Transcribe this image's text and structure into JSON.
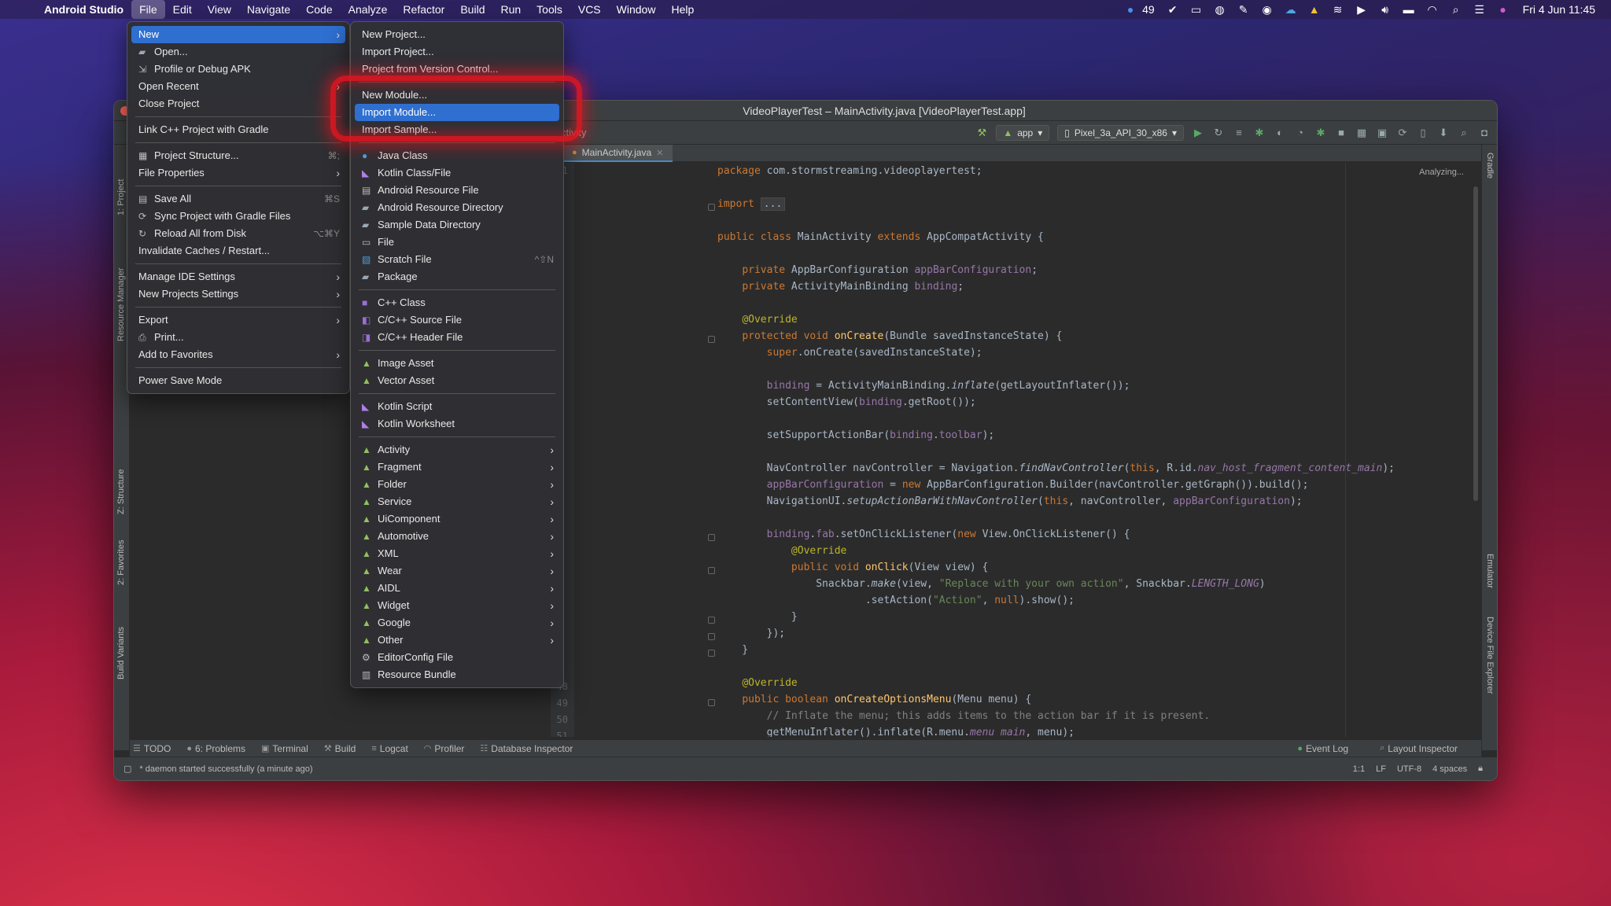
{
  "menubar": {
    "app": "Android Studio",
    "items": [
      "File",
      "Edit",
      "View",
      "Navigate",
      "Code",
      "Analyze",
      "Refactor",
      "Build",
      "Run",
      "Tools",
      "VCS",
      "Window",
      "Help"
    ],
    "badge_count": "49",
    "clock": "Fri 4 Jun  11:45"
  },
  "window": {
    "title": "VideoPlayerTest – MainActivity.java [VideoPlayerTest.app]",
    "breadcrumb": "ctivity",
    "run_config": "app",
    "device": "Pixel_3a_API_30_x86",
    "tab": "MainActivity.java",
    "analyzing": "Analyzing..."
  },
  "side_tabs": {
    "left": [
      "1: Project",
      "Resource Manager",
      "Z: Structure",
      "2: Favorites",
      "Build Variants"
    ],
    "right": [
      "Gradle",
      "Emulator",
      "Device File Explorer"
    ]
  },
  "code": {
    "line_numbers": [
      "1",
      "",
      "",
      "",
      "",
      "",
      "",
      "",
      "",
      "",
      "",
      "",
      "",
      "",
      "",
      "",
      "",
      "",
      "",
      "",
      "",
      "",
      "",
      "",
      "",
      "",
      "",
      "",
      "",
      "",
      "",
      "",
      "48",
      "49",
      "50",
      "51"
    ]
  },
  "bottom_tools": {
    "left": [
      "TODO",
      "6: Problems",
      "Terminal",
      "Build",
      "Logcat",
      "Profiler",
      "Database Inspector"
    ],
    "right": [
      "Event Log",
      "Layout Inspector"
    ]
  },
  "status": {
    "message": "* daemon started successfully (a minute ago)",
    "position": "1:1",
    "line_sep": "LF",
    "encoding": "UTF-8",
    "indent": "4 spaces"
  },
  "file_menu": [
    {
      "label": "New",
      "submenu": true,
      "highlight": true
    },
    {
      "label": "Open...",
      "icon": "folder-icon"
    },
    {
      "label": "Profile or Debug APK",
      "icon": "apk-icon"
    },
    {
      "label": "Open Recent",
      "submenu": true
    },
    {
      "label": "Close Project"
    },
    {
      "sep": true
    },
    {
      "label": "Link C++ Project with Gradle"
    },
    {
      "sep": true
    },
    {
      "label": "Project Structure...",
      "icon": "structure-icon",
      "shortcut": "⌘;"
    },
    {
      "label": "File Properties",
      "submenu": true
    },
    {
      "sep": true
    },
    {
      "label": "Save All",
      "icon": "save-icon",
      "shortcut": "⌘S"
    },
    {
      "label": "Sync Project with Gradle Files",
      "icon": "sync-icon"
    },
    {
      "label": "Reload All from Disk",
      "icon": "reload-icon",
      "shortcut": "⌥⌘Y"
    },
    {
      "label": "Invalidate Caches / Restart..."
    },
    {
      "sep": true
    },
    {
      "label": "Manage IDE Settings",
      "submenu": true
    },
    {
      "label": "New Projects Settings",
      "submenu": true
    },
    {
      "sep": true
    },
    {
      "label": "Export",
      "submenu": true
    },
    {
      "label": "Print...",
      "icon": "print-icon"
    },
    {
      "label": "Add to Favorites",
      "submenu": true
    },
    {
      "sep": true
    },
    {
      "label": "Power Save Mode"
    }
  ],
  "new_menu": [
    {
      "label": "New Project..."
    },
    {
      "label": "Import Project..."
    },
    {
      "label": "Project from Version Control..."
    },
    {
      "sep": true
    },
    {
      "label": "New Module..."
    },
    {
      "label": "Import Module...",
      "highlight": true
    },
    {
      "label": "Import Sample..."
    },
    {
      "sep": true
    },
    {
      "label": "Java Class",
      "icon": "java-class-icon"
    },
    {
      "label": "Kotlin Class/File",
      "icon": "kotlin-icon"
    },
    {
      "label": "Android Resource File",
      "icon": "resource-file-icon"
    },
    {
      "label": "Android Resource Directory",
      "icon": "folder-icon"
    },
    {
      "label": "Sample Data Directory",
      "icon": "folder-icon"
    },
    {
      "label": "File",
      "icon": "file-icon"
    },
    {
      "label": "Scratch File",
      "icon": "scratch-icon",
      "shortcut": "^⇧N"
    },
    {
      "label": "Package",
      "icon": "package-icon"
    },
    {
      "sep": true
    },
    {
      "label": "C++ Class",
      "icon": "cpp-class-icon"
    },
    {
      "label": "C/C++ Source File",
      "icon": "cpp-source-icon"
    },
    {
      "label": "C/C++ Header File",
      "icon": "cpp-header-icon"
    },
    {
      "sep": true
    },
    {
      "label": "Image Asset",
      "icon": "android-icon"
    },
    {
      "label": "Vector Asset",
      "icon": "android-icon"
    },
    {
      "sep": true
    },
    {
      "label": "Kotlin Script",
      "icon": "kotlin-icon"
    },
    {
      "label": "Kotlin Worksheet",
      "icon": "kotlin-icon"
    },
    {
      "sep": true
    },
    {
      "label": "Activity",
      "icon": "android-icon",
      "submenu": true
    },
    {
      "label": "Fragment",
      "icon": "android-icon",
      "submenu": true
    },
    {
      "label": "Folder",
      "icon": "android-icon",
      "submenu": true
    },
    {
      "label": "Service",
      "icon": "android-icon",
      "submenu": true
    },
    {
      "label": "UiComponent",
      "icon": "android-icon",
      "submenu": true
    },
    {
      "label": "Automotive",
      "icon": "android-icon",
      "submenu": true
    },
    {
      "label": "XML",
      "icon": "android-icon",
      "submenu": true
    },
    {
      "label": "Wear",
      "icon": "android-icon",
      "submenu": true
    },
    {
      "label": "AIDL",
      "icon": "android-icon",
      "submenu": true
    },
    {
      "label": "Widget",
      "icon": "android-icon",
      "submenu": true
    },
    {
      "label": "Google",
      "icon": "android-icon",
      "submenu": true
    },
    {
      "label": "Other",
      "icon": "android-icon",
      "submenu": true
    },
    {
      "label": "EditorConfig File",
      "icon": "gear-icon"
    },
    {
      "label": "Resource Bundle",
      "icon": "bundle-icon"
    }
  ]
}
